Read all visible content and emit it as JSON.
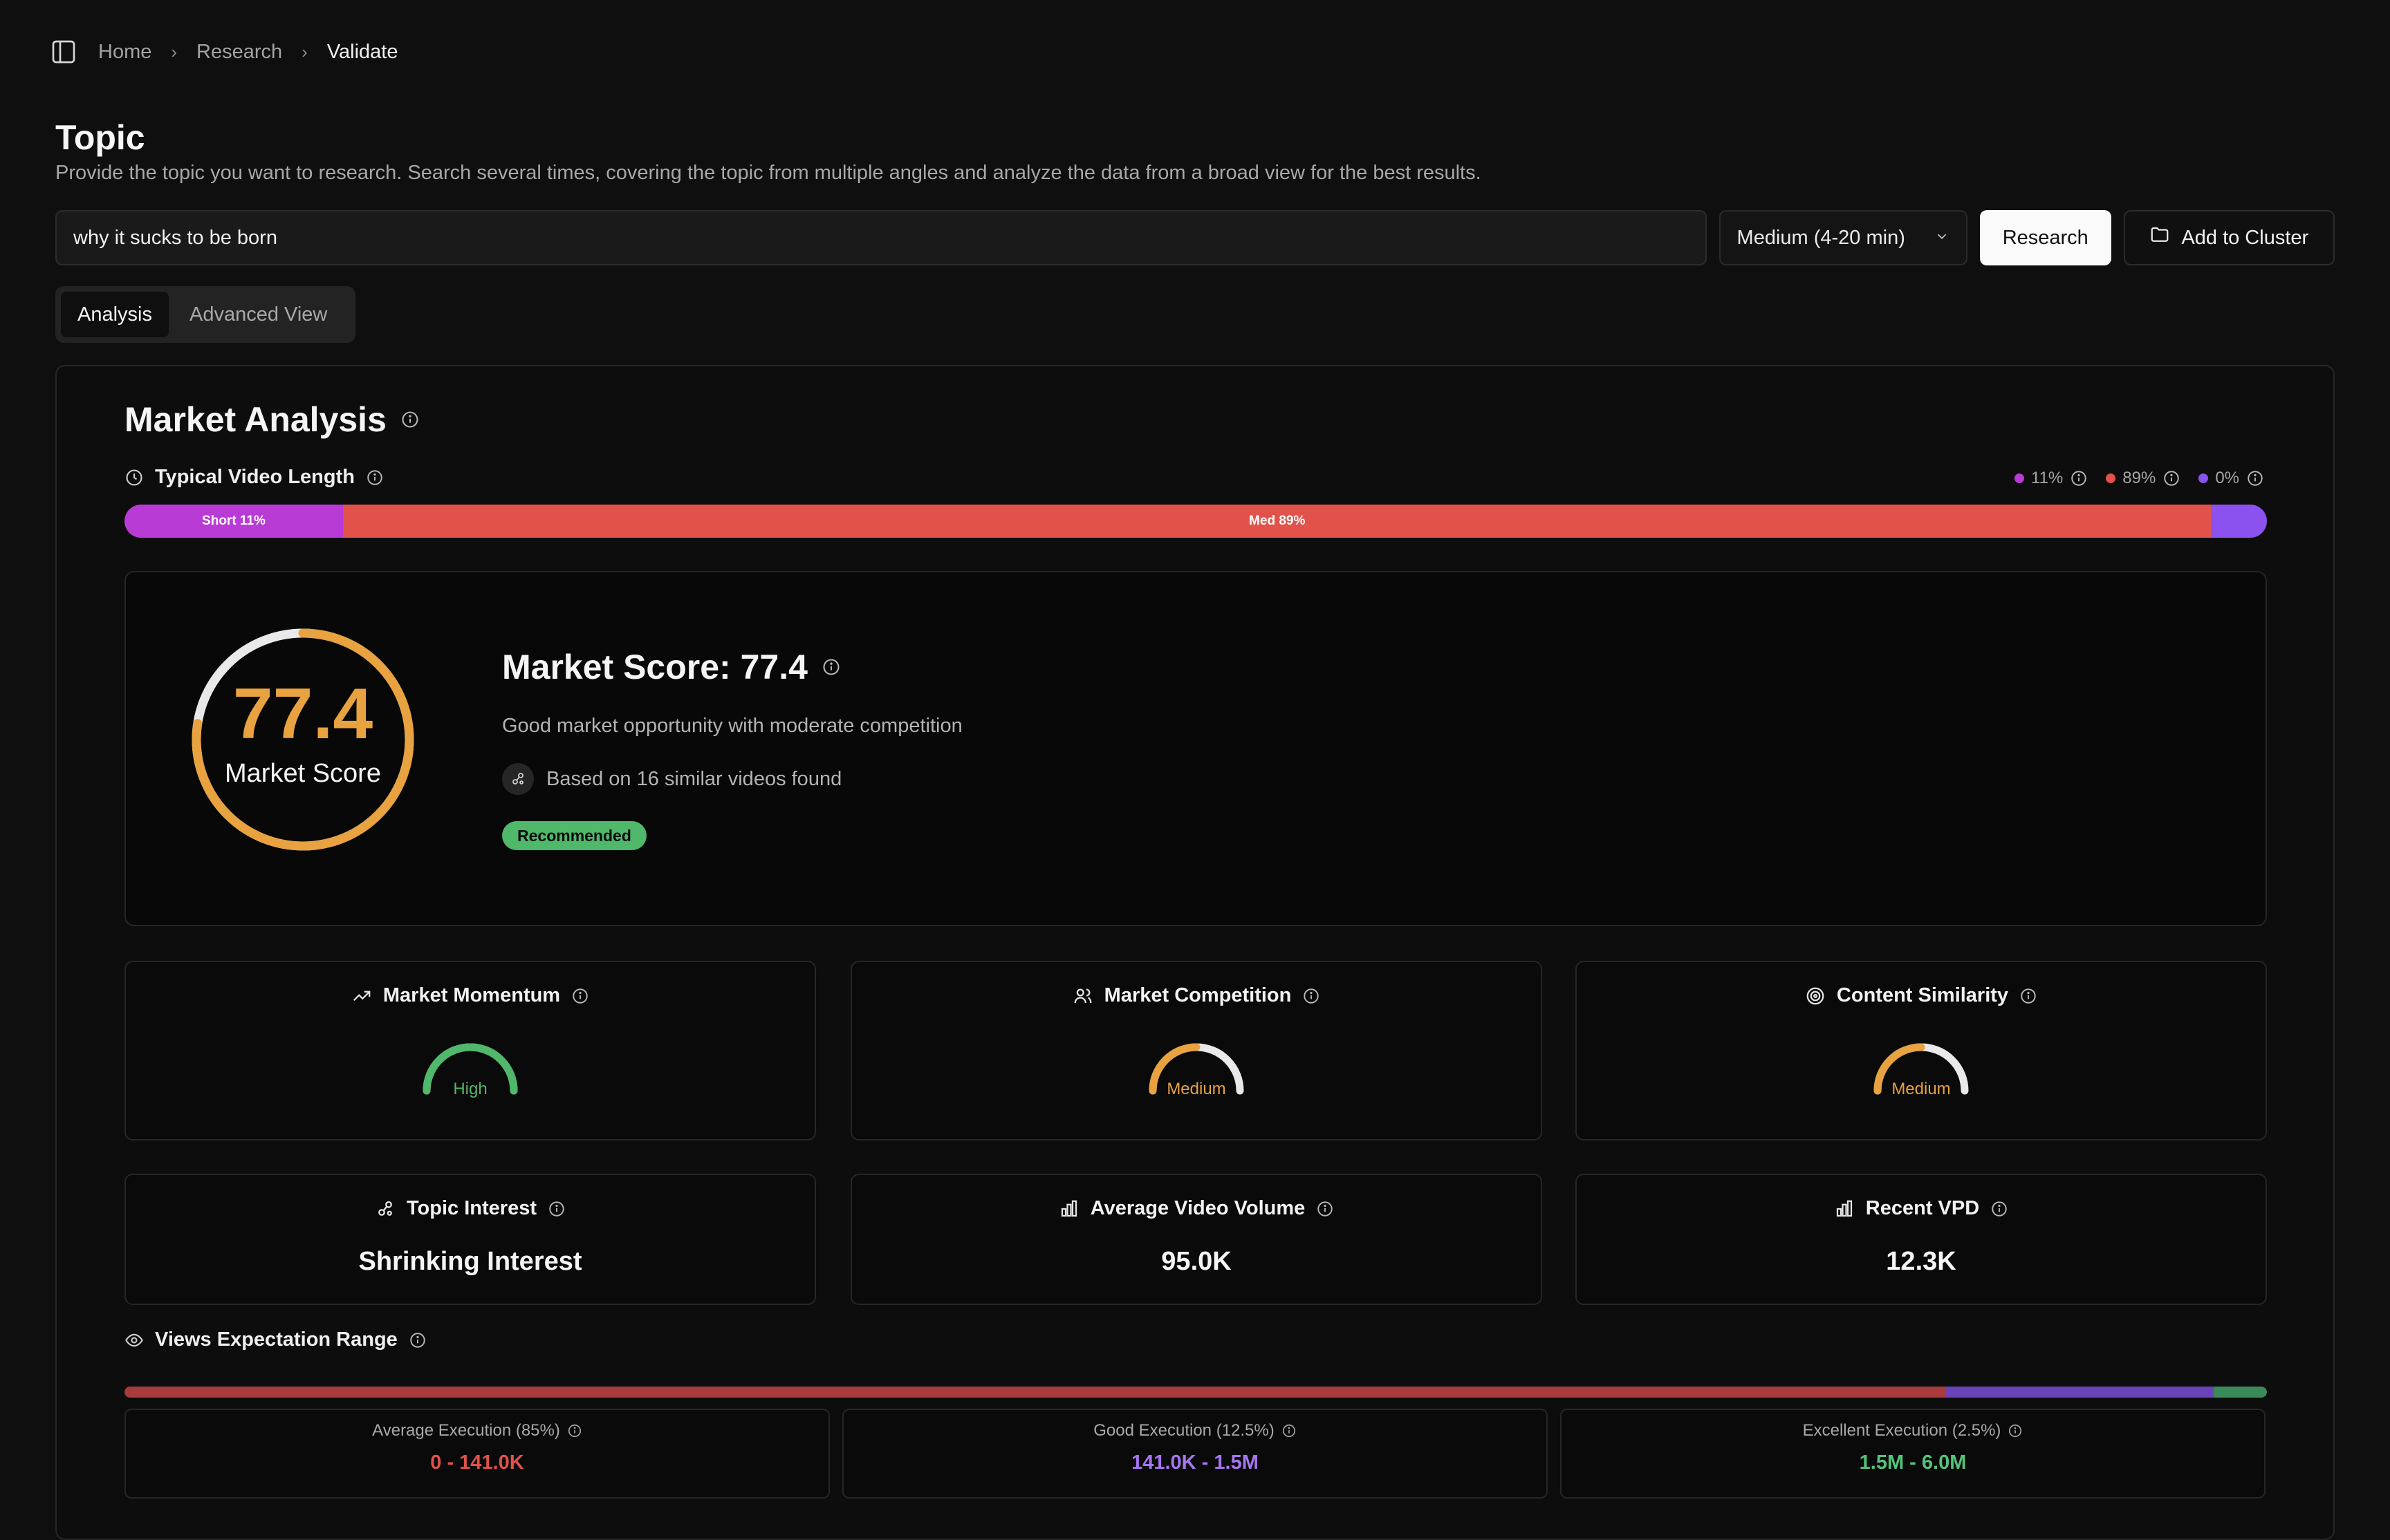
{
  "breadcrumb": [
    "Home",
    "Research",
    "Validate"
  ],
  "topic": {
    "title": "Topic",
    "description": "Provide the topic you want to research. Search several times, covering the topic from multiple angles and analyze the data from a broad view for the best results."
  },
  "search": {
    "value": "why it sucks to be born",
    "duration_select": "Medium (4-20 min)",
    "research_button": "Research",
    "cluster_button": "Add to Cluster"
  },
  "tabs": [
    {
      "label": "Analysis",
      "active": true
    },
    {
      "label": "Advanced View",
      "active": false
    }
  ],
  "market_analysis": {
    "title": "Market Analysis",
    "video_length": {
      "label": "Typical Video Length",
      "legend": [
        {
          "value": "11%",
          "color": "#b93bd6"
        },
        {
          "value": "89%",
          "color": "#e0524a"
        },
        {
          "value": "0%",
          "color": "#8b52f0"
        }
      ],
      "segments": [
        {
          "label": "Short 11%",
          "share": 0.102,
          "color": "#b93bd6"
        },
        {
          "label": "Med 89%",
          "share": 0.872,
          "color": "#e0524a"
        },
        {
          "label": "",
          "share": 0.026,
          "color": "#8b52f0"
        }
      ]
    },
    "score": {
      "value": "77.4",
      "fraction": 0.774,
      "gauge_label": "Market Score",
      "title": "Market Score: 77.4",
      "summary": "Good market opportunity with moderate competition",
      "based_on": "Based on 16 similar videos found",
      "badge": "Recommended",
      "color": "#e8a23f"
    },
    "metrics": [
      {
        "title": "Market Momentum",
        "icon": "trending-up-icon",
        "level": "High",
        "fill": 1.0,
        "color": "#4fb86a"
      },
      {
        "title": "Market Competition",
        "icon": "users-icon",
        "level": "Medium",
        "fill": 0.5,
        "color": "#e8a23f"
      },
      {
        "title": "Content Similarity",
        "icon": "target-icon",
        "level": "Medium",
        "fill": 0.5,
        "color": "#e8a23f"
      }
    ],
    "stats": [
      {
        "title": "Topic Interest",
        "icon": "share-nodes-icon",
        "value": "Shrinking Interest"
      },
      {
        "title": "Average Video Volume",
        "icon": "bar-chart-icon",
        "value": "95.0K"
      },
      {
        "title": "Recent VPD",
        "icon": "bar-chart-icon",
        "value": "12.3K"
      }
    ],
    "views_range": {
      "label": "Views Expectation Range",
      "segments": [
        {
          "label": "Average Execution (85%)",
          "range": "0 - 141.0K",
          "share": 0.85,
          "color": "#a83c3c",
          "text_color": "#e0524a"
        },
        {
          "label": "Good Execution (12.5%)",
          "range": "141.0K - 1.5M",
          "share": 0.125,
          "color": "#6a43b8",
          "text_color": "#a875f0"
        },
        {
          "label": "Excellent Execution (2.5%)",
          "range": "1.5M - 6.0M",
          "share": 0.025,
          "color": "#3b8a5a",
          "text_color": "#55c37a"
        }
      ]
    }
  }
}
